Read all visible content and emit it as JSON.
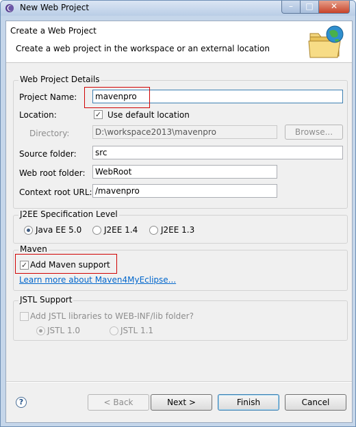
{
  "window": {
    "title": "New Web Project",
    "controls": {
      "minimize": "–",
      "maximize": "□",
      "close": "✕"
    }
  },
  "header": {
    "title": "Create a Web Project",
    "description": "Create a web project in the workspace or an external location",
    "icon": "folder-globe-icon"
  },
  "details": {
    "group_label": "Web Project Details",
    "project_name_label": "Project Name:",
    "project_name_value": "mavenpro",
    "location_label": "Location:",
    "use_default_label": "Use default location",
    "use_default_checked": true,
    "directory_label": "Directory:",
    "directory_value": "D:\\workspace2013\\mavenpro",
    "browse_label": "Browse...",
    "source_folder_label": "Source folder:",
    "source_folder_value": "src",
    "web_root_label": "Web root folder:",
    "web_root_value": "WebRoot",
    "context_root_label": "Context root URL:",
    "context_root_value": "/mavenpro"
  },
  "j2ee": {
    "group_label": "J2EE Specification Level",
    "options": [
      {
        "label": "Java EE 5.0",
        "selected": true
      },
      {
        "label": "J2EE 1.4",
        "selected": false
      },
      {
        "label": "J2EE 1.3",
        "selected": false
      }
    ]
  },
  "maven": {
    "group_label": "Maven",
    "add_support_label": "Add Maven support",
    "add_support_checked": true,
    "learn_more_link": "Learn more about Maven4MyEclipse..."
  },
  "jstl": {
    "group_label": "JSTL Support",
    "add_libs_label": "Add JSTL libraries to WEB-INF/lib folder?",
    "add_libs_checked": false,
    "options": [
      {
        "label": "JSTL 1.0",
        "selected": true
      },
      {
        "label": "JSTL 1.1",
        "selected": false
      }
    ]
  },
  "footer": {
    "help_icon": "help-icon",
    "back_label": "< Back",
    "next_label": "Next >",
    "finish_label": "Finish",
    "cancel_label": "Cancel"
  },
  "colors": {
    "highlight": "#d00000",
    "link": "#0066cc",
    "title_bar": "#c5d6ea"
  }
}
